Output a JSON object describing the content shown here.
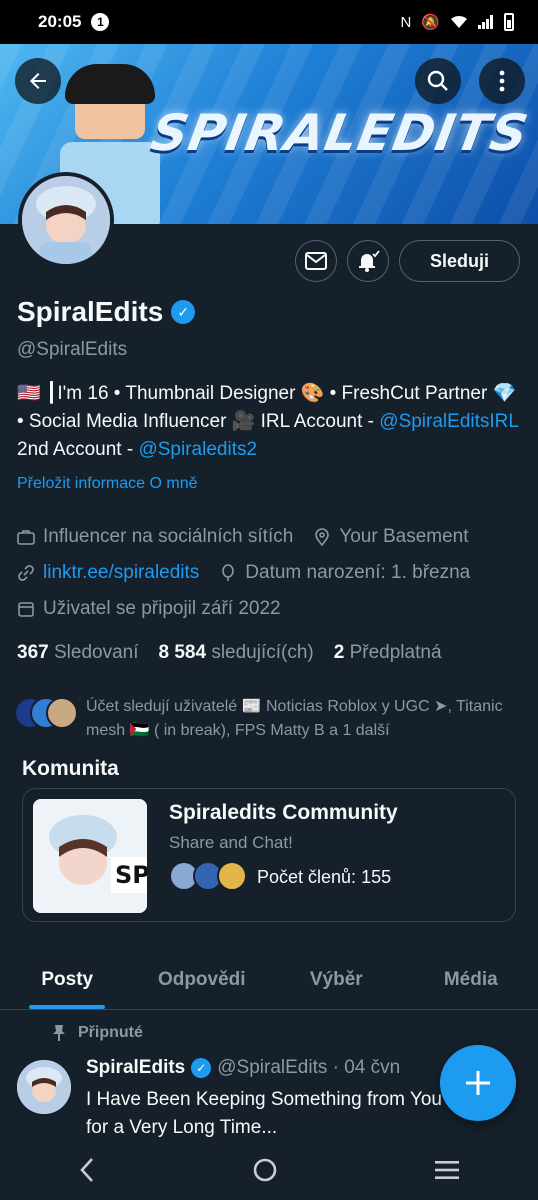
{
  "status_bar": {
    "time": "20:05",
    "notification_count": "1"
  },
  "banner": {
    "logo_text": "SPIRALEDITS"
  },
  "profile": {
    "name": "SpiralEdits",
    "handle": "@SpiralEdits",
    "bio_part1": "🇺🇸 ┃I'm 16 • Thumbnail Designer 🎨 • FreshCut Partner 💎 • Social Media Influencer 🎥  IRL Account - ",
    "bio_link1": "@SpiralEditsIRL",
    "bio_part2": " 2nd Account - ",
    "bio_link2": "@Spiraledits2",
    "translate_label": "Přeložit informace O mně",
    "category": "Influencer na sociálních sítích",
    "location": "Your Basement",
    "website": "linktr.ee/spiraledits",
    "birthday": "Datum narození: 1. března",
    "joined": "Uživatel se připojil září 2022",
    "following_count": "367",
    "following_label": "Sledovaní",
    "followers_count": "8 584",
    "followers_label": "sledující(ch)",
    "subs_count": "2",
    "subs_label": "Předplatná",
    "followed_by": "Účet sledují uživatelé 📰 Noticias Roblox y UGC ➤, Titanic mesh 🇵🇸 ( in break), FPS Matty B a 1 další"
  },
  "actions": {
    "follow_label": "Sleduji"
  },
  "community": {
    "section_title": "Komunita",
    "name": "Spiraledits Community",
    "description": "Share and Chat!",
    "members": "Počet členů: 155"
  },
  "tabs": [
    {
      "label": "Posty"
    },
    {
      "label": "Odpovědi"
    },
    {
      "label": "Výběr"
    },
    {
      "label": "Média"
    }
  ],
  "pinned_post": {
    "pinned_label": "Připnuté",
    "author": "SpiralEdits",
    "meta": "@SpiralEdits · 04 čvn",
    "text": "I Have Been Keeping Something from You for a Very Long Time..."
  },
  "colors": {
    "accent": "#1d9bf0",
    "background": "#15202b",
    "muted": "#8b98a5"
  }
}
